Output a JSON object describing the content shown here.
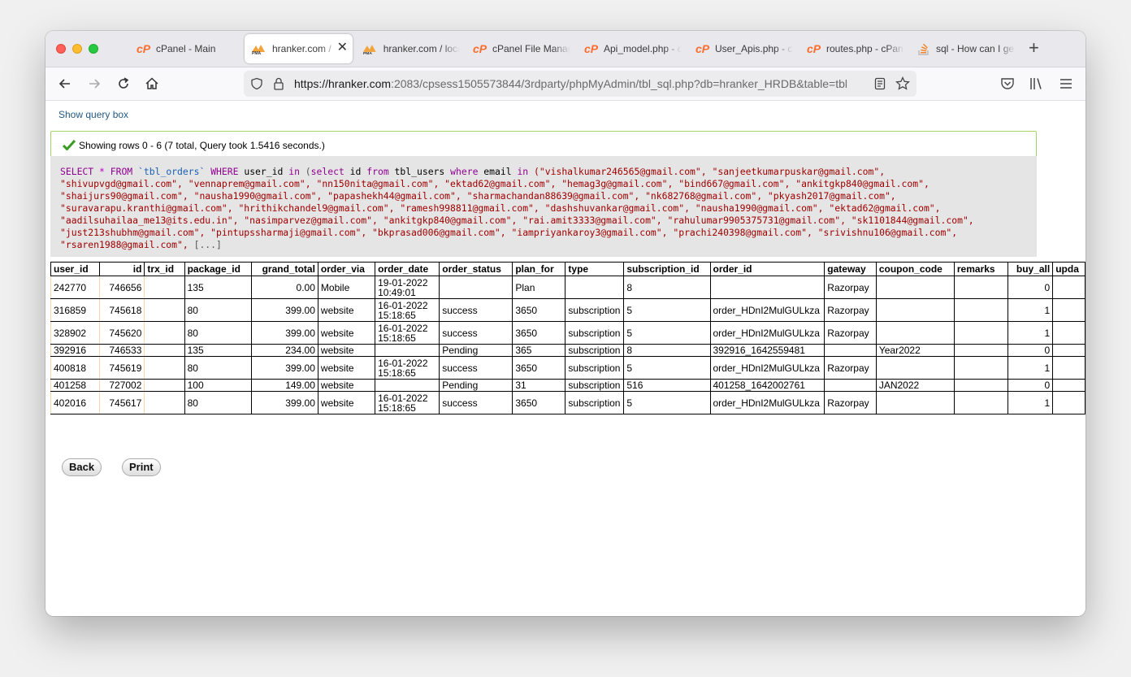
{
  "tabs": [
    {
      "icon": "cpanel-icon",
      "label": "cPanel - Main",
      "active": false
    },
    {
      "icon": "phpmyadmin-icon",
      "label": "hranker.com / lo",
      "active": true
    },
    {
      "icon": "phpmyadmin-icon",
      "label": "hranker.com / loca",
      "active": false
    },
    {
      "icon": "cpanel-icon",
      "label": "cPanel File Manag",
      "active": false
    },
    {
      "icon": "cpanel-icon",
      "label": "Api_model.php - c",
      "active": false
    },
    {
      "icon": "cpanel-icon",
      "label": "User_Apis.php - c",
      "active": false
    },
    {
      "icon": "cpanel-icon",
      "label": "routes.php - cPan",
      "active": false
    },
    {
      "icon": "stackoverflow-icon",
      "label": "sql - How can I ge",
      "active": false
    }
  ],
  "address": {
    "host": "https://hranker.com",
    "path": ":2083/cpsess1505573844/3rdparty/phpMyAdmin/tbl_sql.php?db=hranker_HRDB&table=tbl"
  },
  "show_query_label": "Show query box",
  "success_message": "Showing rows 0 - 6 (7 total, Query took 1.5416 seconds.)",
  "sql": {
    "select": "SELECT",
    "star": "*",
    "from": "FROM",
    "table": "`tbl_orders`",
    "where": "WHERE",
    "col1": "user_id",
    "in1": "in",
    "paren": "(",
    "select2": "select",
    "id": "id",
    "from2": "from",
    "tbl2": "tbl_users",
    "where2": "where",
    "email": "email",
    "in2": "in",
    "lines": [
      "(\"vishalkumar246565@gmail.com\", \"sanjeetkumarpuskar@gmail.com\",",
      "\"shivupvgd@gmail.com\", \"vennaprem@gmail.com\", \"nn150nita@gmail.com\", \"ektad62@gmail.com\", \"hemag3g@gmail.com\", \"bind667@gmail.com\", \"ankitgkp840@gmail.com\",",
      "\"shaijurs90@gmail.com\", \"nausha1990@gmail.com\", \"papashekh44@gmail.com\", \"sharmachandan88639@gmail.com\", \"nk682768@gmail.com\", \"pkyash2017@gmail.com\",",
      "\"suravarapu.kranthi@gmail.com\", \"hrithikchandel9@gmail.com\", \"ramesh998811@gmail.com\", \"dashshuvankar@gmail.com\", \"nausha1990@gmail.com\", \"ektad62@gmail.com\",",
      "\"aadilsuhailaa_me13@its.edu.in\", \"nasimparvez@gmail.com\", \"ankitgkp840@gmail.com\", \"rai.amit3333@gmail.com\", \"rahulumar9905375731@gmail.com\", \"sk1101844@gmail.com\",",
      "\"just213shubhm@gmail.com\", \"pintupssharmaji@gmail.com\", \"bkprasad006@gmail.com\", \"iampriyankaroy3@gmail.com\", \"prachi240398@gmail.com\", \"srivishnu106@gmail.com\",",
      "\"rsaren1988@gmail.com\","
    ],
    "ellipsis": "[...]"
  },
  "columns": [
    "user_id",
    "id",
    "trx_id",
    "package_id",
    "grand_total",
    "order_via",
    "order_date",
    "order_status",
    "plan_for",
    "type",
    "subscription_id",
    "order_id",
    "gateway",
    "coupon_code",
    "remarks",
    "buy_all",
    "upda"
  ],
  "rows": [
    [
      "242770",
      "746656",
      "",
      "135",
      "0.00",
      "Mobile",
      "19-01-2022\n10:49:01",
      "",
      "Plan",
      "",
      "8",
      "",
      "Razorpay",
      "",
      "",
      "0",
      ""
    ],
    [
      "316859",
      "745618",
      "",
      "80",
      "399.00",
      "website",
      "16-01-2022\n15:18:65",
      "success",
      "3650",
      "subscription",
      "5",
      "order_HDnI2MulGULkza",
      "Razorpay",
      "",
      "",
      "1",
      ""
    ],
    [
      "328902",
      "745620",
      "",
      "80",
      "399.00",
      "website",
      "16-01-2022\n15:18:65",
      "success",
      "3650",
      "subscription",
      "5",
      "order_HDnI2MulGULkza",
      "Razorpay",
      "",
      "",
      "1",
      ""
    ],
    [
      "392916",
      "746533",
      "",
      "135",
      "234.00",
      "website",
      "",
      "Pending",
      "365",
      "subscription",
      "8",
      "392916_1642559481",
      "",
      "Year2022",
      "",
      "0",
      ""
    ],
    [
      "400818",
      "745619",
      "",
      "80",
      "399.00",
      "website",
      "16-01-2022\n15:18:65",
      "success",
      "3650",
      "subscription",
      "5",
      "order_HDnI2MulGULkza",
      "Razorpay",
      "",
      "",
      "1",
      ""
    ],
    [
      "401258",
      "727002",
      "",
      "100",
      "149.00",
      "website",
      "",
      "Pending",
      "31",
      "subscription",
      "516",
      "401258_1642002761",
      "",
      "JAN2022",
      "",
      "0",
      ""
    ],
    [
      "402016",
      "745617",
      "",
      "80",
      "399.00",
      "website",
      "16-01-2022\n15:18:65",
      "success",
      "3650",
      "subscription",
      "5",
      "order_HDnI2MulGULkza",
      "Razorpay",
      "",
      "",
      "1",
      ""
    ]
  ],
  "buttons": {
    "back": "Back",
    "print": "Print"
  }
}
